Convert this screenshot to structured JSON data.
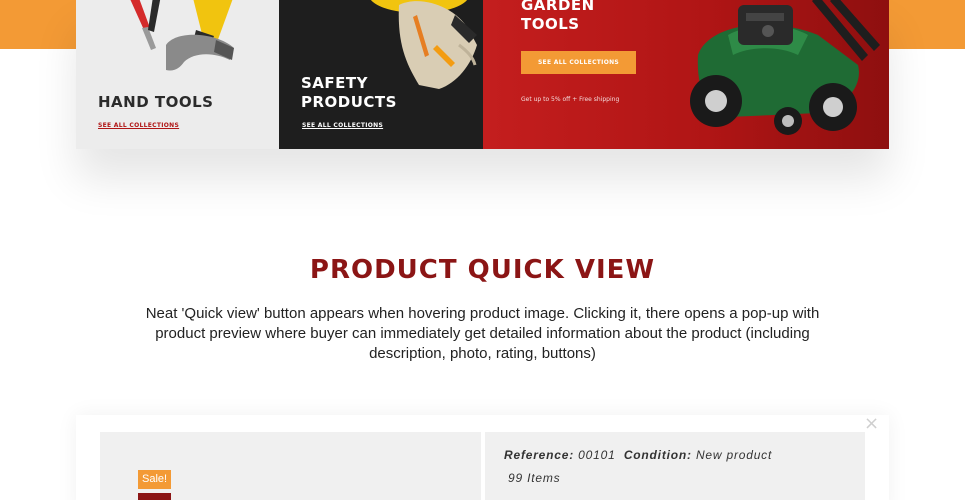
{
  "banners": [
    {
      "title": "HAND TOOLS",
      "link": "SEE ALL COLLECTIONS"
    },
    {
      "title_line1": "SAFETY",
      "title_line2": "PRODUCTS",
      "link": "SEE ALL COLLECTIONS"
    },
    {
      "title_line1": "GARDEN",
      "title_line2": "TOOLS",
      "button": "SEE ALL COLLECTIONS",
      "note": "Get up to 5% off + Free shipping"
    }
  ],
  "section": {
    "title": "PRODUCT QUICK VIEW",
    "description": "Neat 'Quick view' button appears when hovering product image. Clicking it, there opens a pop-up with product preview where buyer can immediately get detailed information about the product (including description, photo, rating, buttons)"
  },
  "quickview": {
    "close": "×",
    "sale_badge": "Sale!",
    "reference_label": "Reference:",
    "reference_value": "00101",
    "condition_label": "Condition:",
    "condition_value": "New product",
    "items": "99 Items"
  },
  "colors": {
    "accent_orange": "#f39a35",
    "brand_red": "#8b1515",
    "banner_red": "#c41e1e"
  },
  "icons": [
    "hammer-icon",
    "gloves-icon",
    "lawn-mower-icon",
    "close-icon"
  ]
}
